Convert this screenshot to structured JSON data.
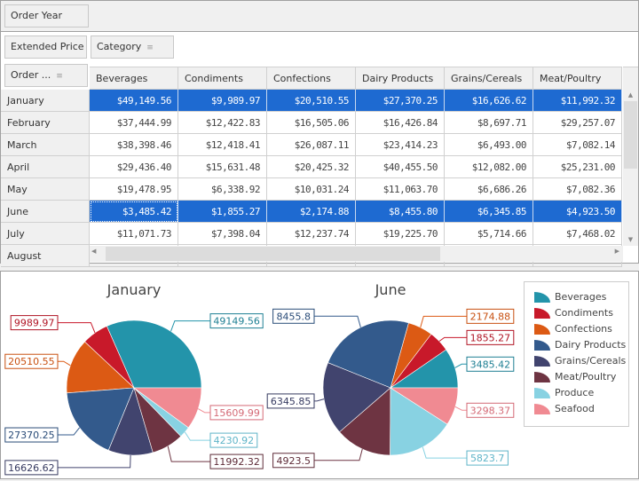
{
  "pivot": {
    "filter_area_field": "Order Year",
    "data_field": "Extended Price",
    "column_field": "Category",
    "row_field": "Order ...",
    "columns": [
      "Beverages",
      "Condiments",
      "Confections",
      "Dairy Products",
      "Grains/Cereals",
      "Meat/Poultry"
    ],
    "rows": [
      {
        "label": "January",
        "values": [
          "$49,149.56",
          "$9,989.97",
          "$20,510.55",
          "$27,370.25",
          "$16,626.62",
          "$11,992.32"
        ],
        "selected": true
      },
      {
        "label": "February",
        "values": [
          "$37,444.99",
          "$12,422.83",
          "$16,505.06",
          "$16,426.84",
          "$8,697.71",
          "$29,257.07"
        ]
      },
      {
        "label": "March",
        "values": [
          "$38,398.46",
          "$12,418.41",
          "$26,087.11",
          "$23,414.23",
          "$6,493.00",
          "$7,082.14"
        ]
      },
      {
        "label": "April",
        "values": [
          "$29,436.40",
          "$15,631.48",
          "$20,425.32",
          "$40,455.50",
          "$12,082.00",
          "$25,231.00"
        ]
      },
      {
        "label": "May",
        "values": [
          "$19,478.95",
          "$6,338.92",
          "$10,031.24",
          "$11,063.70",
          "$6,686.26",
          "$7,082.36"
        ]
      },
      {
        "label": "June",
        "values": [
          "$3,485.42",
          "$1,855.27",
          "$2,174.88",
          "$8,455.80",
          "$6,345.85",
          "$4,923.50"
        ],
        "selected": true
      },
      {
        "label": "July",
        "values": [
          "$11,071.73",
          "$7,398.04",
          "$12,237.74",
          "$19,225.70",
          "$5,714.66",
          "$7,468.02"
        ]
      },
      {
        "label": "August",
        "values": []
      }
    ]
  },
  "chart_data": [
    {
      "type": "pie",
      "title": "January",
      "categories": [
        "Beverages",
        "Condiments",
        "Confections",
        "Dairy Products",
        "Grains/Cereals",
        "Meat/Poultry",
        "Produce",
        "Seafood"
      ],
      "values": [
        49149.56,
        9989.97,
        20510.55,
        27370.25,
        16626.62,
        11992.32,
        4230.92,
        15609.99
      ],
      "labels": [
        "49149.56",
        "9989.97",
        "20510.55",
        "27370.25",
        "16626.62",
        "11992.32",
        "4230.92",
        "15609.99"
      ]
    },
    {
      "type": "pie",
      "title": "June",
      "categories": [
        "Beverages",
        "Condiments",
        "Confections",
        "Dairy Products",
        "Grains/Cereals",
        "Meat/Poultry",
        "Produce",
        "Seafood"
      ],
      "values": [
        3485.42,
        1855.27,
        2174.88,
        8455.8,
        6345.85,
        4923.5,
        5823.7,
        3298.37
      ],
      "labels": [
        "3485.42",
        "1855.27",
        "2174.88",
        "8455.8",
        "6345.85",
        "4923.5",
        "5823.7",
        "3298.37"
      ]
    }
  ],
  "legend": {
    "placement": "right",
    "items": [
      "Beverages",
      "Condiments",
      "Confections",
      "Dairy Products",
      "Grains/Cereals",
      "Meat/Poultry",
      "Produce",
      "Seafood"
    ]
  },
  "colors": {
    "series": [
      "#2394aa",
      "#c8192a",
      "#dc5a14",
      "#335a8c",
      "#41446e",
      "#6e3442",
      "#88d2e2",
      "#f08a92"
    ],
    "label_text": [
      "#1e7f93",
      "#b01424",
      "#c85010",
      "#2a4c78",
      "#363a60",
      "#5e2c38",
      "#5fb4c8",
      "#d46a76"
    ],
    "selection": "#1e6ad1"
  }
}
